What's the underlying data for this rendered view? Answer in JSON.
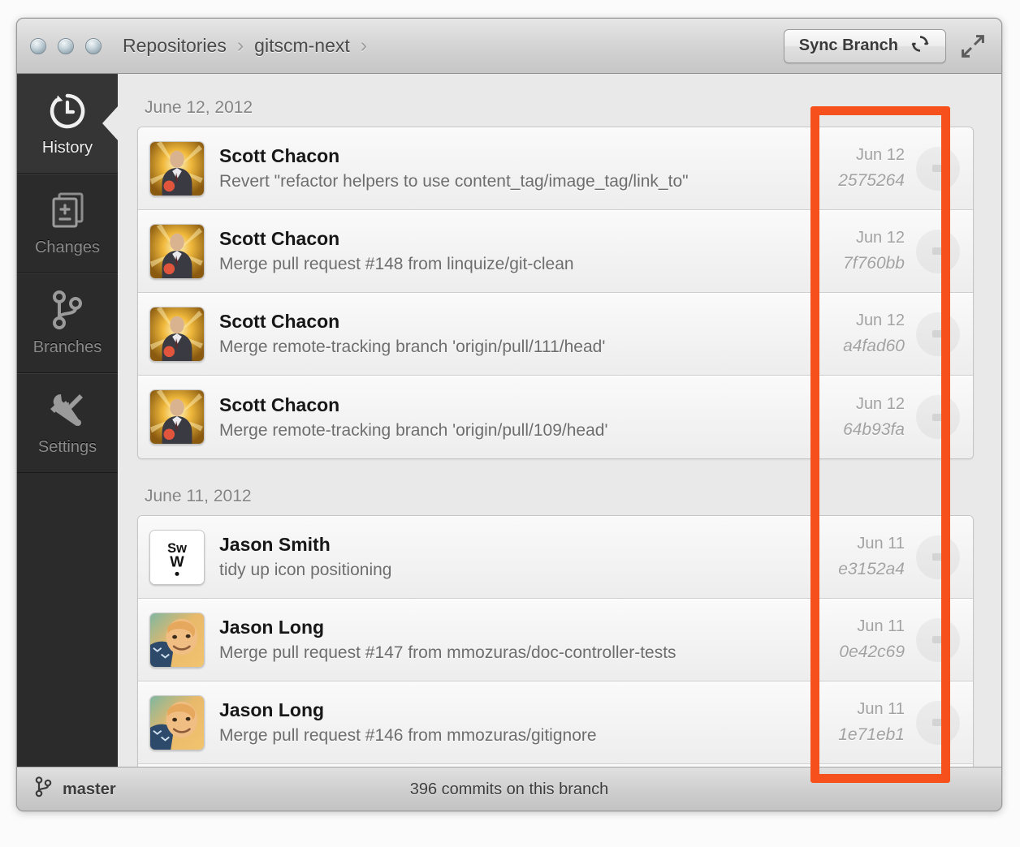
{
  "window": {
    "traffic_lights": [
      "close",
      "minimize",
      "zoom"
    ],
    "breadcrumb": [
      "Repositories",
      "gitscm-next"
    ],
    "breadcrumb_separator": "›",
    "sync_button": "Sync Branch",
    "sync_icon": "refresh-icon",
    "expand_icon": "fullscreen-icon"
  },
  "sidebar": {
    "items": [
      {
        "label": "History",
        "icon": "history-clock-icon",
        "active": true
      },
      {
        "label": "Changes",
        "icon": "file-plus-minus-icon",
        "active": false
      },
      {
        "label": "Branches",
        "icon": "branch-fork-icon",
        "active": false
      },
      {
        "label": "Settings",
        "icon": "wrench-screwdriver-icon",
        "active": false
      }
    ]
  },
  "history": {
    "groups": [
      {
        "date_header": "June 12, 2012",
        "commits": [
          {
            "author": "Scott Chacon",
            "message": "Revert \"refactor helpers to use content_tag/image_tag/link_to\"",
            "date": "Jun 12",
            "sha": "2575264",
            "avatar": "scott-chacon-avatar"
          },
          {
            "author": "Scott Chacon",
            "message": "Merge pull request #148 from linquize/git-clean",
            "date": "Jun 12",
            "sha": "7f760bb",
            "avatar": "scott-chacon-avatar"
          },
          {
            "author": "Scott Chacon",
            "message": "Merge remote-tracking branch 'origin/pull/111/head'",
            "date": "Jun 12",
            "sha": "a4fad60",
            "avatar": "scott-chacon-avatar"
          },
          {
            "author": "Scott Chacon",
            "message": "Merge remote-tracking branch 'origin/pull/109/head'",
            "date": "Jun 12",
            "sha": "64b93fa",
            "avatar": "scott-chacon-avatar"
          }
        ]
      },
      {
        "date_header": "June 11, 2012",
        "commits": [
          {
            "author": "Jason Smith",
            "message": "tidy up icon positioning",
            "date": "Jun 11",
            "sha": "e3152a4",
            "avatar": "sww-logo-avatar"
          },
          {
            "author": "Jason Long",
            "message": "Merge pull request #147 from mmozuras/doc-controller-tests",
            "date": "Jun 11",
            "sha": "0e42c69",
            "avatar": "jason-long-avatar"
          },
          {
            "author": "Jason Long",
            "message": "Merge pull request #146 from mmozuras/gitignore",
            "date": "Jun 11",
            "sha": "1e71eb1",
            "avatar": "jason-long-avatar"
          }
        ]
      }
    ],
    "row_action_icon": "disclosure-dash-icon"
  },
  "statusbar": {
    "branch_icon": "branch-icon",
    "branch": "master",
    "commit_count": "396 commits on this branch"
  },
  "annotation": {
    "color": "#f6511d",
    "shape": "rectangle-highlight"
  }
}
